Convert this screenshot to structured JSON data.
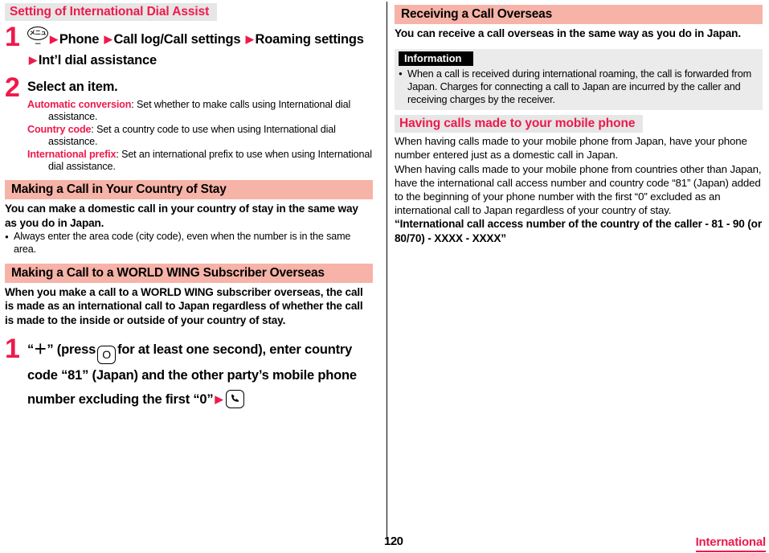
{
  "page": {
    "number": "120",
    "footer_tag": "International"
  },
  "left": {
    "section_setting": {
      "heading": "Setting of International Dial Assist",
      "step1": {
        "num": "1",
        "menu_icon_label": "メニュー",
        "parts": [
          "Phone",
          "Call log/Call settings",
          "Roaming settings",
          "Int’l dial assistance"
        ]
      },
      "step2": {
        "num": "2",
        "title": "Select an item.",
        "items": [
          {
            "term": "Automatic conversion",
            "desc": ": Set whether to make calls using International dial assistance."
          },
          {
            "term": "Country code",
            "desc": ": Set a country code to use when using International dial assistance."
          },
          {
            "term": "International prefix",
            "desc": ": Set an international prefix to use when using International dial assistance."
          }
        ]
      }
    },
    "section_domestic": {
      "heading": "Making a Call in Your Country of Stay",
      "body": "You can make a domestic call in your country of stay in the same way as you do in Japan.",
      "bullet": "Always enter the area code (city code), even when the number is in the same area."
    },
    "section_worldwing": {
      "heading": "Making a Call to a WORLD WING Subscriber Overseas",
      "body": "When you make a call to a WORLD WING subscriber overseas, the call is made as an international call to Japan regardless of whether the call is made to the inside or outside of your country of stay.",
      "step1": {
        "num": "1",
        "text_a": "“＋” (press",
        "key_label": "O",
        "text_b": "for at least one second), enter country code “81” (Japan) and the other party’s mobile phone number excluding the first “0”"
      }
    }
  },
  "right": {
    "section_receiving": {
      "heading": "Receiving a Call Overseas",
      "body": "You can receive a call overseas in the same way as you do in Japan.",
      "info": {
        "title": "Information",
        "bullet": "When a call is received during international roaming, the call is forwarded from Japan. Charges for connecting a call to Japan are incurred by the caller and receiving charges by the receiver."
      }
    },
    "section_having": {
      "heading": "Having calls made to your mobile phone",
      "para1": "When having calls made to your mobile phone from Japan, have your phone number entered just as a domestic call in Japan.",
      "para2": "When having calls made to your mobile phone from countries other than Japan, have the international call access number and country code “81” (Japan) added to the beginning of your phone number with the first “0” excluded as an international call to Japan regardless of your country of stay.",
      "para3": "“International call access number of the country of the caller - 81 - 90 (or 80/70) - XXXX - XXXX”"
    }
  }
}
